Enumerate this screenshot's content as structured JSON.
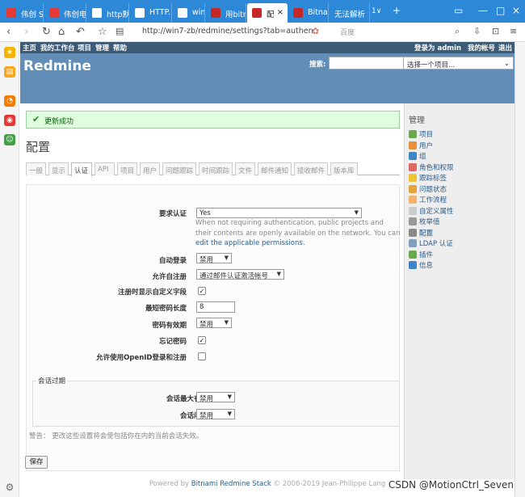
{
  "browser": {
    "tabs": [
      {
        "label": "伟创 S",
        "active": false
      },
      {
        "label": "伟创电",
        "active": false
      },
      {
        "label": "http默",
        "active": false
      },
      {
        "label": "HTTP.",
        "active": false
      },
      {
        "label": "windo",
        "active": false
      },
      {
        "label": "用bitn",
        "active": false
      },
      {
        "label": "配",
        "active": true
      },
      {
        "label": "Bitnam",
        "active": false
      },
      {
        "label": "无法解析",
        "active": false
      }
    ],
    "tab_count": "1∨",
    "url": "http://win7-zb/redmine/settings?tab=authen",
    "search_placeholder": "百度"
  },
  "topmenu": {
    "left": [
      "主页",
      "我的工作台",
      "项目",
      "管理",
      "帮助"
    ],
    "logged_in_as": "登录为 admin",
    "my_account": "我的帐号",
    "logout": "退出"
  },
  "header": {
    "brand": "Redmine",
    "search_label": "搜索:",
    "project_select": "选择一个项目..."
  },
  "flash": "更新成功",
  "page_title": "配置",
  "tabs": [
    "一般",
    "显示",
    "认证",
    "API",
    "项目",
    "用户",
    "问题跟踪",
    "时间跟踪",
    "文件",
    "邮件通知",
    "接收邮件",
    "版本库"
  ],
  "form": {
    "login_required": {
      "label": "要求认证",
      "value": "Yes"
    },
    "info_text": "When not requiring authentication, public projects and their contents are openly available on the network. You can",
    "info_link": "edit the applicable permissions.",
    "autologin": {
      "label": "自动登录",
      "value": "禁用"
    },
    "self_registration": {
      "label": "允许自注册",
      "value": "通过邮件认证激活帐号"
    },
    "show_custom_fields": {
      "label": "注册时显示自定义字段",
      "checked": true
    },
    "min_password_length": {
      "label": "最短密码长度",
      "value": "8"
    },
    "password_max_age": {
      "label": "密码有效期",
      "value": "禁用"
    },
    "lost_password": {
      "label": "忘记密码",
      "checked": true
    },
    "openid": {
      "label": "允许使用OpenID登录和注册",
      "checked": false
    }
  },
  "session": {
    "legend": "会话过期",
    "lifetime": {
      "label": "会话最大有效时间",
      "value": "禁用"
    },
    "timeout": {
      "label": "会话闲置超时",
      "value": "禁用"
    },
    "warning": "警告： 更改这些设置将会使包括你在内的当前会话失效。"
  },
  "save_label": "保存",
  "footer": {
    "prefix": "Powered by ",
    "link": "Bitnami Redmine Stack",
    "suffix": " © 2006-2019 Jean-Philippe Lang"
  },
  "watermark": "CSDN @MotionCtrl_Seven",
  "admin_menu": {
    "title": "管理",
    "items": [
      {
        "label": "项目",
        "color": "#6aa84f"
      },
      {
        "label": "用户",
        "color": "#e69138"
      },
      {
        "label": "组",
        "color": "#3d85c6"
      },
      {
        "label": "角色和权限",
        "color": "#e06666"
      },
      {
        "label": "跟踪标签",
        "color": "#f1c232"
      },
      {
        "label": "问题状态",
        "color": "#e6a23c"
      },
      {
        "label": "工作流程",
        "color": "#f6b26b"
      },
      {
        "label": "自定义属性",
        "color": "#cccccc"
      },
      {
        "label": "枚举值",
        "color": "#999999"
      },
      {
        "label": "配置",
        "color": "#8a8a8a",
        "current": true
      },
      {
        "label": "LDAP 认证",
        "color": "#7f9fbf"
      },
      {
        "label": "插件",
        "color": "#6aa84f"
      },
      {
        "label": "信息",
        "color": "#3d85c6"
      }
    ]
  }
}
